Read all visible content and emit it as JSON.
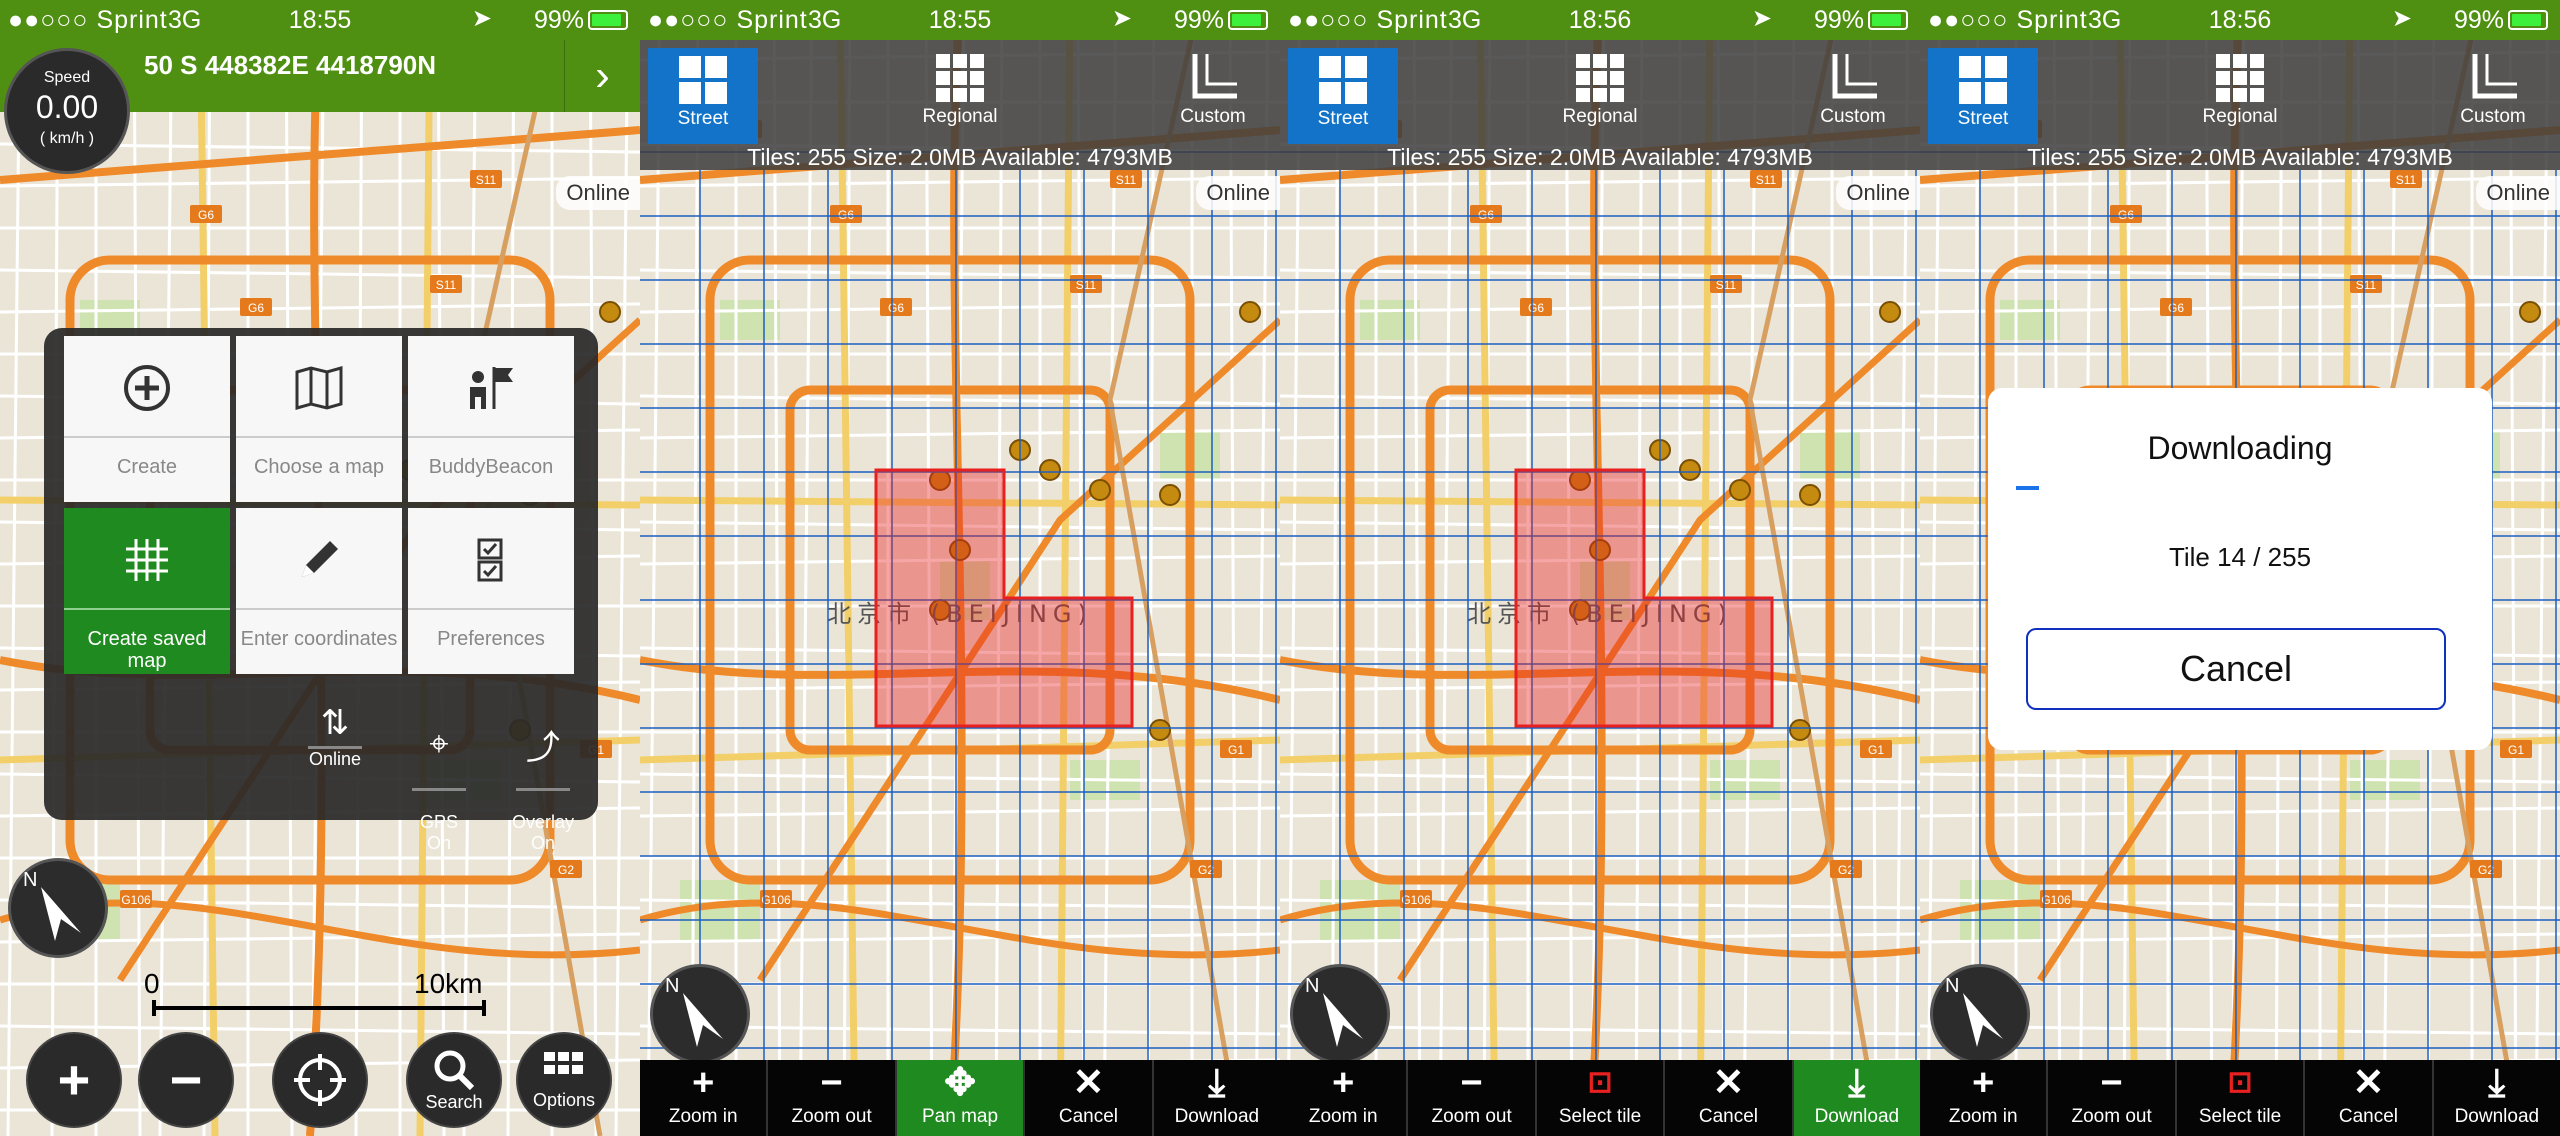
{
  "status": {
    "carrier": "●●○○○ Sprint",
    "network": "3G",
    "battery": "99%"
  },
  "times": [
    "18:55",
    "18:55",
    "18:56",
    "18:56"
  ],
  "screen1": {
    "coords": "50 S 448382E 4418790N",
    "speed": {
      "label": "Speed",
      "value": "0.00",
      "unit": "( km/h )"
    },
    "online_badge": "Online",
    "menu": [
      {
        "label": "Create",
        "icon": "plus-circle-icon"
      },
      {
        "label": "Choose a map",
        "icon": "map-icon"
      },
      {
        "label": "BuddyBeacon",
        "icon": "buddy-flag-icon"
      },
      {
        "label": "Create saved map",
        "icon": "grid-icon",
        "selected": true
      },
      {
        "label": "Enter coordinates",
        "icon": "pencil-icon"
      },
      {
        "label": "Preferences",
        "icon": "checklist-icon"
      }
    ],
    "toggles": [
      {
        "label": "Online",
        "icon": "online-arrows-icon"
      },
      {
        "label": "GPS\nOn",
        "icon": "gps-target-icon"
      },
      {
        "label": "Overlay\nOn",
        "icon": "overlay-track-icon"
      }
    ],
    "scale": {
      "zero": "0",
      "max": "10km"
    },
    "buttons": [
      {
        "label": "",
        "icon": "zoom-in-icon"
      },
      {
        "label": "",
        "icon": "zoom-out-icon"
      },
      {
        "label": "",
        "icon": "locate-icon"
      },
      {
        "label": "Search",
        "icon": "search-icon"
      },
      {
        "label": "Options",
        "icon": "options-grid-icon"
      }
    ]
  },
  "maptypes": {
    "street": "Street",
    "regional": "Regional",
    "custom": "Custom"
  },
  "tiles_info": "Tiles: 255  Size: 2.0MB  Available: 4793MB",
  "online_badge": "Online",
  "city_label": "北京市 (BEIJING)",
  "toolbar_pan": [
    "Zoom in",
    "Zoom out",
    "Pan map",
    "Cancel",
    "Download"
  ],
  "toolbar_select": [
    "Zoom in",
    "Zoom out",
    "Select tile",
    "Cancel",
    "Download"
  ],
  "dialog": {
    "title": "Downloading",
    "progress": 0.055,
    "message": "Tile 14 / 255",
    "cancel": "Cancel"
  },
  "colors": {
    "accent_green": "#1f8a1f",
    "status_green": "#4f8f12",
    "select_blue": "#1273c9",
    "region_red": "#e82020"
  }
}
